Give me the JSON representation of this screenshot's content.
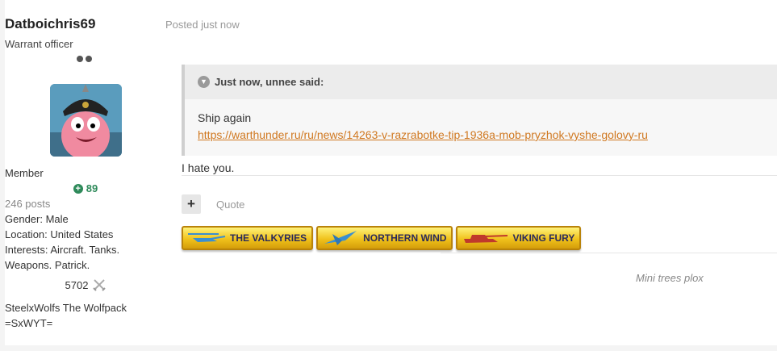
{
  "author": {
    "username": "Datboichris69",
    "rank": "Warrant officer",
    "group": "Member",
    "reputation": "89",
    "posts": "246 posts",
    "gender": "Gender: Male",
    "location": "Location: United States",
    "interests_line1": "Interests: Aircraft. Tanks.",
    "interests_line2": "Weapons. Patrick.",
    "kills": "5702",
    "squadron_line1": "SteelxWolfs The Wolfpack",
    "squadron_line2": "=SxWYT="
  },
  "post": {
    "posted": "Posted just now",
    "quote_header": "Just now, unnee said:",
    "quote_text": "Ship again",
    "quote_link": "https://warthunder.ru/ru/news/14263-v-razrabotke-tip-1936a-mob-pryzhok-vyshe-golovy-ru",
    "reply": "I hate you.",
    "plus_label": "+",
    "quote_button": "Quote"
  },
  "badges": [
    {
      "label": "THE VALKYRIES",
      "icon": "helicopter-icon"
    },
    {
      "label": "NORTHERN WIND",
      "icon": "jet-icon"
    },
    {
      "label": "VIKING FURY",
      "icon": "tank-icon"
    }
  ],
  "signature": "Mini trees plox",
  "colors": {
    "link": "#d07820",
    "reputation": "#2e8a5a",
    "badge_gold": "#f0c21c"
  }
}
